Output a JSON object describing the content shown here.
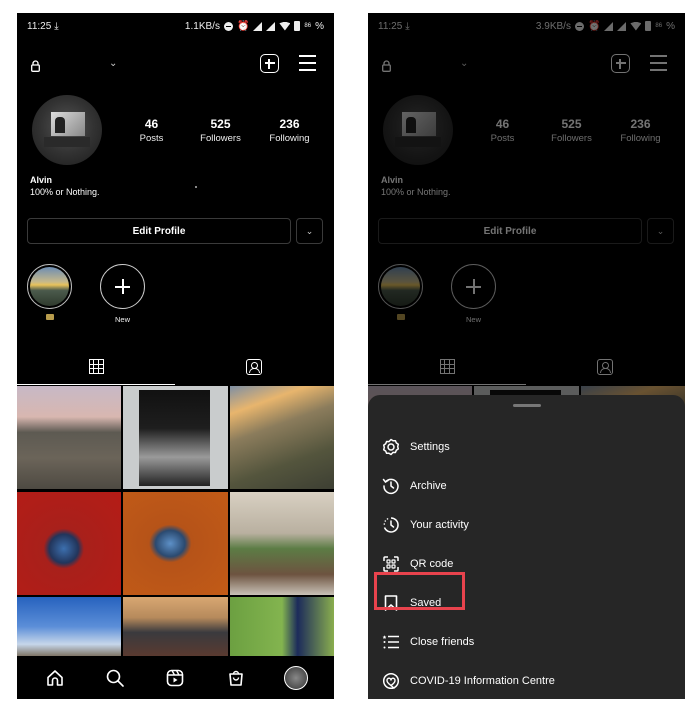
{
  "screens": [
    {
      "status_bar": {
        "time": "11:25",
        "speed": "1.1KB/s",
        "battery": "86"
      },
      "profile": {
        "stats": [
          {
            "value": "46",
            "label": "Posts"
          },
          {
            "value": "525",
            "label": "Followers"
          },
          {
            "value": "236",
            "label": "Following"
          }
        ],
        "name": "Alvin",
        "bio": "100% or Nothing.",
        "edit_profile_label": "Edit Profile",
        "highlights": [
          {
            "label": ""
          },
          {
            "label": "New"
          }
        ]
      }
    },
    {
      "status_bar": {
        "time": "11:25",
        "speed": "3.9KB/s",
        "battery": "86"
      },
      "profile": {
        "stats": [
          {
            "value": "46",
            "label": "Posts"
          },
          {
            "value": "525",
            "label": "Followers"
          },
          {
            "value": "236",
            "label": "Following"
          }
        ],
        "name": "Alvin",
        "bio": "100% or Nothing.",
        "edit_profile_label": "Edit Profile",
        "highlights": [
          {
            "label": ""
          },
          {
            "label": "New"
          }
        ]
      },
      "menu_sheet": {
        "items": [
          {
            "label": "Settings",
            "icon": "settings-icon"
          },
          {
            "label": "Archive",
            "icon": "archive-icon"
          },
          {
            "label": "Your activity",
            "icon": "activity-icon"
          },
          {
            "label": "QR code",
            "icon": "qr-code-icon"
          },
          {
            "label": "Saved",
            "icon": "bookmark-icon",
            "highlighted": true
          },
          {
            "label": "Close friends",
            "icon": "close-friends-icon"
          },
          {
            "label": "COVID-19 Information Centre",
            "icon": "covid-info-icon"
          }
        ],
        "highlight_color": "#e8434d"
      }
    }
  ],
  "bottom_nav": [
    "home-icon",
    "search-icon",
    "reels-icon",
    "shop-icon",
    "profile-avatar"
  ],
  "colors": {
    "background": "#000000",
    "sheet": "#262626",
    "highlight": "#e8434d"
  }
}
